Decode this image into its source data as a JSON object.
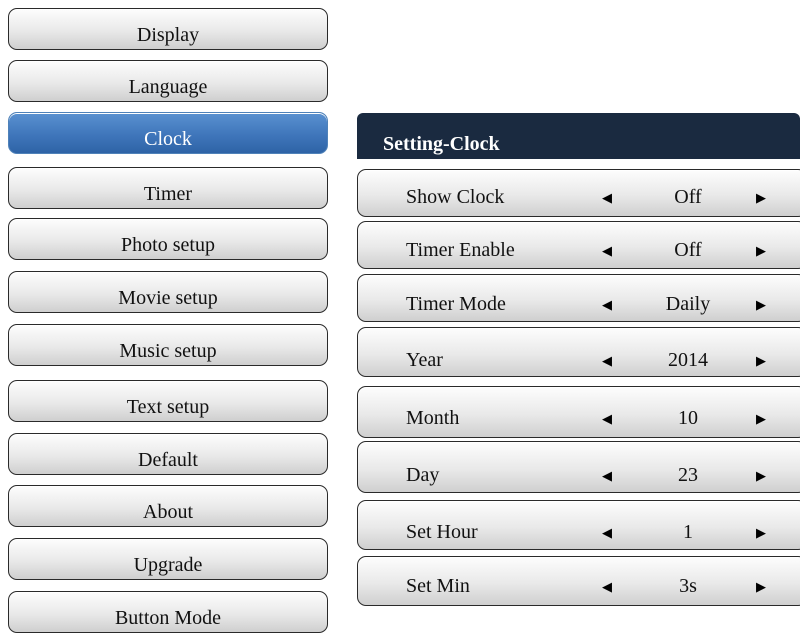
{
  "menu": {
    "items": [
      {
        "label": "Display"
      },
      {
        "label": "Language"
      },
      {
        "label": "Clock"
      },
      {
        "label": "Timer"
      },
      {
        "label": "Photo setup"
      },
      {
        "label": "Movie setup"
      },
      {
        "label": "Music setup"
      },
      {
        "label": "Text setup"
      },
      {
        "label": "Default"
      },
      {
        "label": "About"
      },
      {
        "label": "Upgrade"
      },
      {
        "label": "Button Mode"
      }
    ],
    "selected": "Clock"
  },
  "panel": {
    "title": "Setting-Clock",
    "rows": [
      {
        "label": "Show Clock",
        "value": "Off"
      },
      {
        "label": "Timer Enable",
        "value": "Off"
      },
      {
        "label": "Timer Mode",
        "value": "Daily"
      },
      {
        "label": "Year",
        "value": "2014"
      },
      {
        "label": "Month",
        "value": "10"
      },
      {
        "label": "Day",
        "value": "23"
      },
      {
        "label": "Set Hour",
        "value": "1"
      },
      {
        "label": "Set Min",
        "value": "3s"
      }
    ]
  },
  "icons": {
    "left_arrow": "left-triangle",
    "right_arrow": "right-triangle"
  },
  "colors": {
    "selected_bg": "#3f76bb",
    "header_bg": "#1a2a40"
  }
}
